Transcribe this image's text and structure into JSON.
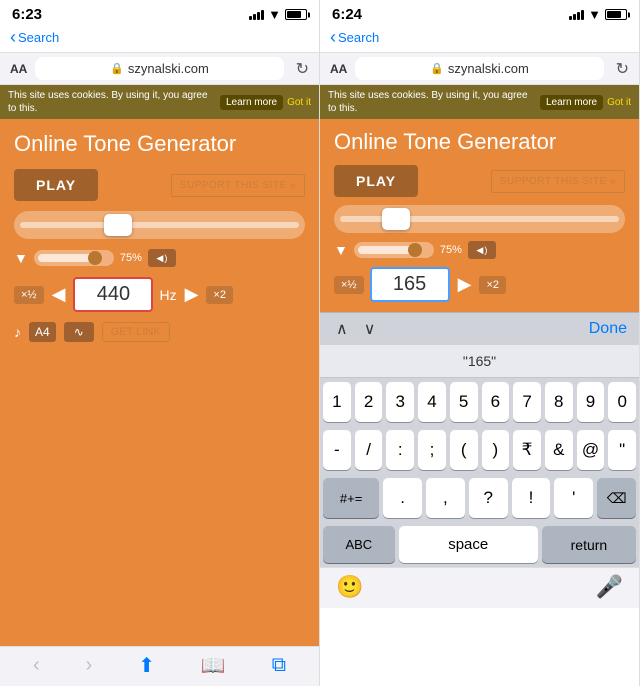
{
  "left_panel": {
    "status": {
      "time": "6:23",
      "search_label": "Search"
    },
    "browser": {
      "aa": "AA",
      "domain": "szynalski.com",
      "lock": "🔒",
      "refresh": "↻"
    },
    "cookie": {
      "text": "This site uses cookies. By using it, you agree to this.",
      "learn_more": "Learn more",
      "got_it": "Got it"
    },
    "page": {
      "title": "Online Tone Generator",
      "play_label": "PLAY",
      "support_label": "SUPPORT THIS SITE »",
      "volume_pct": "75%",
      "frequency": "440",
      "hz_label": "Hz",
      "half_label": "×½",
      "double_label": "×2",
      "note_label": "A4",
      "get_link_label": "GET LINK"
    }
  },
  "right_panel": {
    "status": {
      "time": "6:24",
      "search_label": "Search"
    },
    "browser": {
      "aa": "AA",
      "domain": "szynalski.com",
      "lock": "🔒",
      "refresh": "↻"
    },
    "cookie": {
      "text": "This site uses cookies. By using it, you agree to this.",
      "learn_more": "Learn more",
      "got_it": "Got it"
    },
    "page": {
      "title": "Online Tone Generator",
      "play_label": "PLAY",
      "support_label": "SUPPORT THIS SITE »",
      "volume_pct": "75%",
      "frequency": "165",
      "hz_label": "",
      "half_label": "×½",
      "double_label": "×2"
    },
    "keyboard": {
      "suggestion": "\"165\"",
      "done_label": "Done",
      "up_arrow": "∧",
      "down_arrow": "∨",
      "rows": [
        [
          "1",
          "2",
          "3",
          "4",
          "5",
          "6",
          "7",
          "8",
          "9",
          "0"
        ],
        [
          "-",
          "/",
          ":",
          ";",
          "(",
          ")",
          "₹",
          "&",
          "@",
          "\""
        ],
        [
          "#+=",
          ".",
          "،",
          "?",
          "!",
          "'",
          "⌫"
        ],
        [
          "ABC",
          "space",
          "return"
        ]
      ]
    }
  }
}
